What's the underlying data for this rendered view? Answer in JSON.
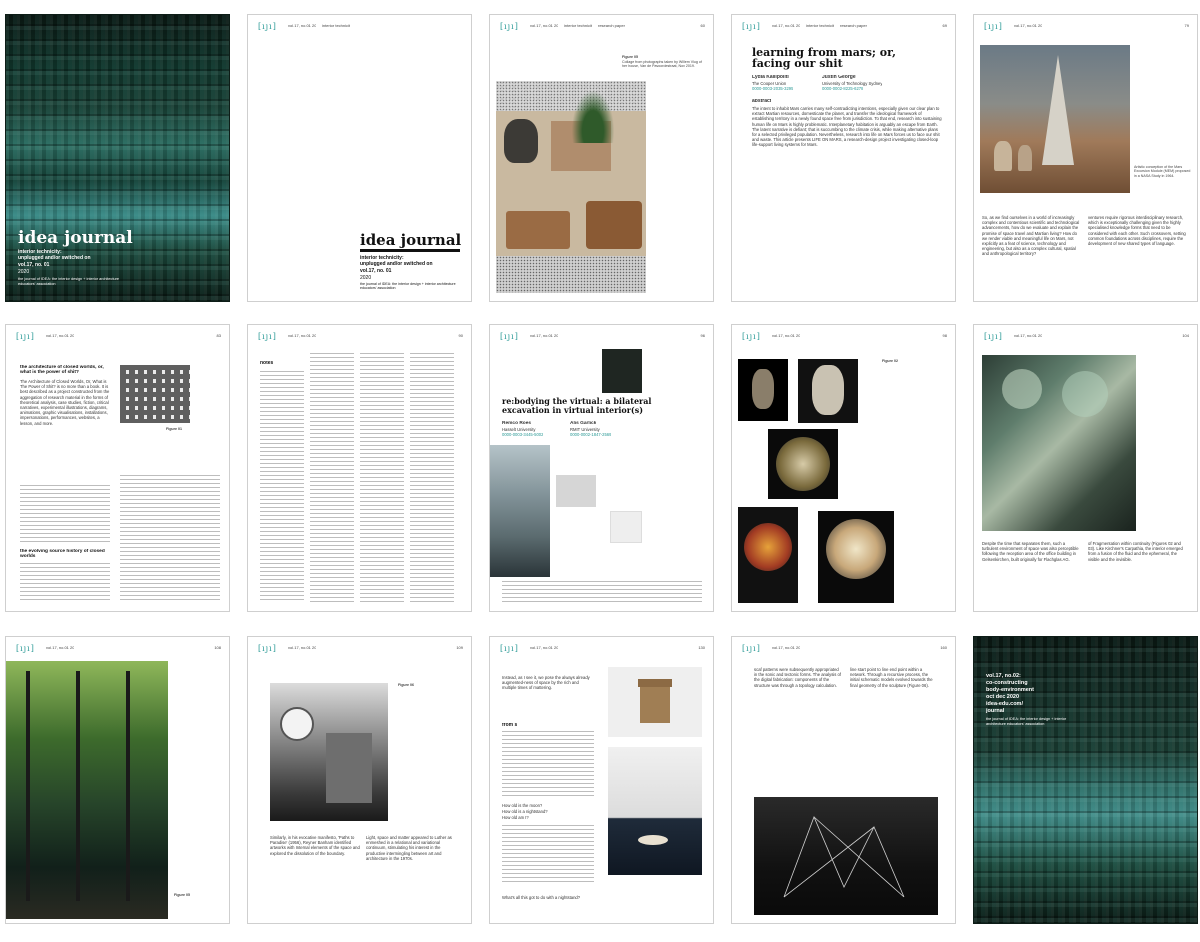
{
  "cover1": {
    "title": "idea journal",
    "subtitle1": "interior technicity:",
    "subtitle2": "unplugged and/or switched on",
    "volume": "vol.17, no. 01",
    "year": "2020",
    "imprint": "the journal of IDEA: the interior design + interior architecture educators' association"
  },
  "title_page": {
    "title": "idea journal",
    "subtitle1": "interior technicity:",
    "subtitle2": "unplugged and/or switched on",
    "volume": "vol.17, no. 01",
    "year": "2020",
    "imprint": "the journal of IDEA: the interior design + interior architecture educators' association"
  },
  "running_header": {
    "logo": "[ıȷı]",
    "vol": "vol.17, no.01 2020",
    "theme": "interior technicity",
    "type": "research paper"
  },
  "p3": {
    "page_no": "60",
    "fig_label": "Figure 05",
    "caption": "Collage from photographs taken by Willem Vlug of her house, Van de Pavoordestraat, Nov 2019."
  },
  "p4": {
    "page_no": "69",
    "title1": "learning from mars; or,",
    "title2": "facing our shit",
    "author1": "Lydia Kallipoliti",
    "affil1": "The Cooper Union",
    "orcid1": "0000-0003-2035-3295",
    "author2": "Justin George",
    "affil2": "University of Technology Sydney",
    "orcid2": "0000-0002-8225-6278",
    "abstract_head": "abstract",
    "abstract": "The intent to inhabit Mars carries many self-contradicting intentions, especially given our clear plan to extract Martian resources, domesticate the planet, and transfer the ideological framework of establishing territory in a newly found space free from jurisdiction. To that end, research into sustaining human life on Mars is highly problematic. Interplanetary habitation is arguably an escape from Earth. The latent narrative is defiant; that is succumbing to the climate crisis, while making alternative plans for a selected privileged population. Nevertheless, research into life on Mars forces us to face our shit and waste. This article presents LIFE ON MARS, a research-design project investigating closed-loop life-support living systems for Mars."
  },
  "p5": {
    "page_no": "79",
    "caption": "Artistic conception of the Mars Excursion Module (MEM) proposed in a NASA Study in 1964.",
    "col1": "So, as we find ourselves in a world of increasingly complex and contentious scientific and technological advancements, how do we evaluate and explain the promise of space travel and Martian living? How do we render viable and meaningful life on Mars, not explicitly as a feat of science, technology and engineering, but also as a complex cultural, spatial and anthropological territory?",
    "col2": "ventures require rigorous interdisciplinary research, which is exceptionally challenging given the highly specialised knowledge forms that need to be considered with each other. Such crossovers, setting common foundations across disciplines, require the development of new shared types of language."
  },
  "p6": {
    "page_no": "83",
    "head": "the architecture of closed worlds, or, what is the power of shit?",
    "body": "The Architecture of Closed Worlds, Or, What is The Power of Shit? is no more than a book. It is best described as a project constructed from the aggregation of research material in the forms of theoretical analysis, case studies, fiction, critical narratives, experimental illustrations, diagrams, animations, graphic visualisations, installations, impersonations, performances, websites, a lesson, and more.",
    "subhead": "the evolving source history of closed worlds",
    "fig": "Figure 01"
  },
  "p7": {
    "page_no": "90",
    "head": "notes"
  },
  "p8": {
    "page_no": "96",
    "title1": "re:bodying the virtual: a bilateral",
    "title2": "excavation in virtual interior(s)",
    "author1": "Remco Roes",
    "affil1": "Hasselt University",
    "orcid1": "0000-0003-3445-5002",
    "author2": "Alis Garlick",
    "affil2": "RMIT University",
    "orcid2": "0000-0002-1847-2569"
  },
  "p9": {
    "page_no": "98",
    "fig": "Figure 02"
  },
  "p10": {
    "page_no": "104",
    "col1": "Despite the time that separates them, such a turbulent environment of space was also perceptible following the reception area of the office building in Gelsenkirchen, built originally for Flachglas AG.",
    "col2": "of Fragmentation within continuity (Figures 02 and 03). Like Kirchner's Carpathia, the interior emerged from a fusion of the fluid and the ephemeral, the visible and the invisible."
  },
  "p11": {
    "page_no": "108",
    "fig": "Figure 05"
  },
  "p12": {
    "page_no": "109",
    "caption": "Figure 06",
    "col1": "Similarly, in his evocative manifesto, 'Paths to Paradise' (1956), Reyner Banham identified artworks with Internal elements of the space and explored the dissolution of the boundary.",
    "col2": "Light, space and matter appeared to Luther as enmeshed in a relational and variational continuum, stimulating his interest in the productive intermingling between art and architecture in the 1970s."
  },
  "p13": {
    "page_no": "130",
    "head": "from s",
    "intro": "Instead, as I see it, we pose the always already augmented-ness of space by the rich and multiple times of mattering.",
    "q1": "How old is the moon?",
    "q2": "How old is a nightstand?",
    "q3": "How old am I?",
    "end": "What's all this got to do with a nightstand?"
  },
  "p14": {
    "page_no": "160",
    "col1": "scaf patterns were subsequently appropriated in the sonic and tectonic forms. The analysis of the digital fabrication: components of the structure was through a topology calculation.",
    "col2": "line start point to line end point within a network. Through a recursive process, the initial schematic models evolved towards the final geometry of the sculpture (Figure 06)."
  },
  "back_cover": {
    "l1": "vol.17, no.02:",
    "l2": "co-constructing",
    "l3": "body-environment",
    "l4": "oct dec 2020",
    "l5": "idea-edu.com/",
    "l6": "journal",
    "l7": "the journal of IDEA: the interior design + interior architecture educators' association"
  }
}
